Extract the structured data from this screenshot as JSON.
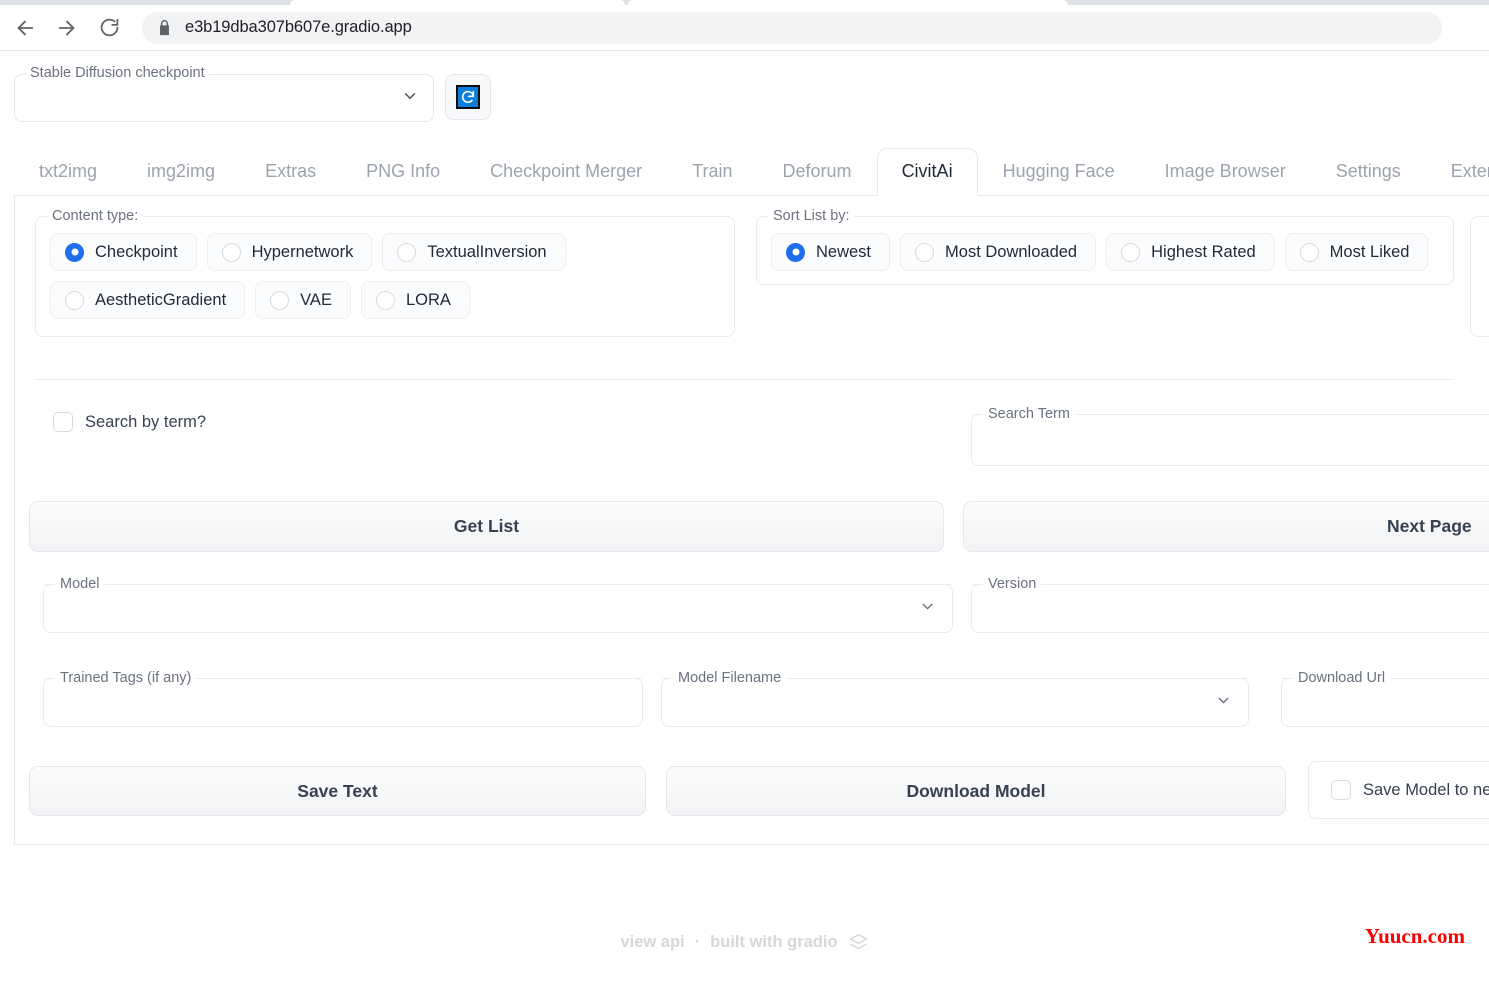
{
  "browser": {
    "back_icon": "back-arrow-icon",
    "forward_icon": "forward-arrow-icon",
    "reload_icon": "reload-icon",
    "lock_icon": "lock-icon",
    "url": "e3b19dba307b607e.gradio.app"
  },
  "checkpoint": {
    "legend": "Stable Diffusion checkpoint",
    "value": "",
    "refresh_icon": "refresh-icon"
  },
  "tabs": [
    {
      "label": "txt2img",
      "selected": false
    },
    {
      "label": "img2img",
      "selected": false
    },
    {
      "label": "Extras",
      "selected": false
    },
    {
      "label": "PNG Info",
      "selected": false
    },
    {
      "label": "Checkpoint Merger",
      "selected": false
    },
    {
      "label": "Train",
      "selected": false
    },
    {
      "label": "Deforum",
      "selected": false
    },
    {
      "label": "CivitAi",
      "selected": true
    },
    {
      "label": "Hugging Face",
      "selected": false
    },
    {
      "label": "Image Browser",
      "selected": false
    },
    {
      "label": "Settings",
      "selected": false
    },
    {
      "label": "Extensions",
      "selected": false
    }
  ],
  "content_type": {
    "legend": "Content type:",
    "selected": "Checkpoint",
    "options": [
      "Checkpoint",
      "Hypernetwork",
      "TextualInversion",
      "AestheticGradient",
      "VAE",
      "LORA"
    ]
  },
  "sort_list": {
    "legend": "Sort List by:",
    "selected": "Newest",
    "options": [
      "Newest",
      "Most Downloaded",
      "Highest Rated",
      "Most Liked"
    ]
  },
  "search": {
    "checkbox_label": "Search by term?",
    "checked": false,
    "term_label": "Search Term",
    "term_value": ""
  },
  "actions": {
    "get_list": "Get List",
    "next_page": "Next Page",
    "save_text": "Save Text",
    "download_model": "Download Model",
    "save_model_checkbox": "Save Model to new",
    "save_model_checked": false
  },
  "fields": {
    "model_label": "Model",
    "model_value": "",
    "version_label": "Version",
    "version_value": "",
    "trained_tags_label": "Trained Tags (if any)",
    "trained_tags_value": "",
    "model_filename_label": "Model Filename",
    "model_filename_value": "",
    "download_url_label": "Download Url",
    "download_url_value": ""
  },
  "footer": {
    "view_api": "view api",
    "separator": "·",
    "built_with": "built with gradio",
    "logo_icon": "gradio-logo-icon"
  },
  "watermark": {
    "text": "Yuucn.com",
    "color": "#ff0000"
  }
}
